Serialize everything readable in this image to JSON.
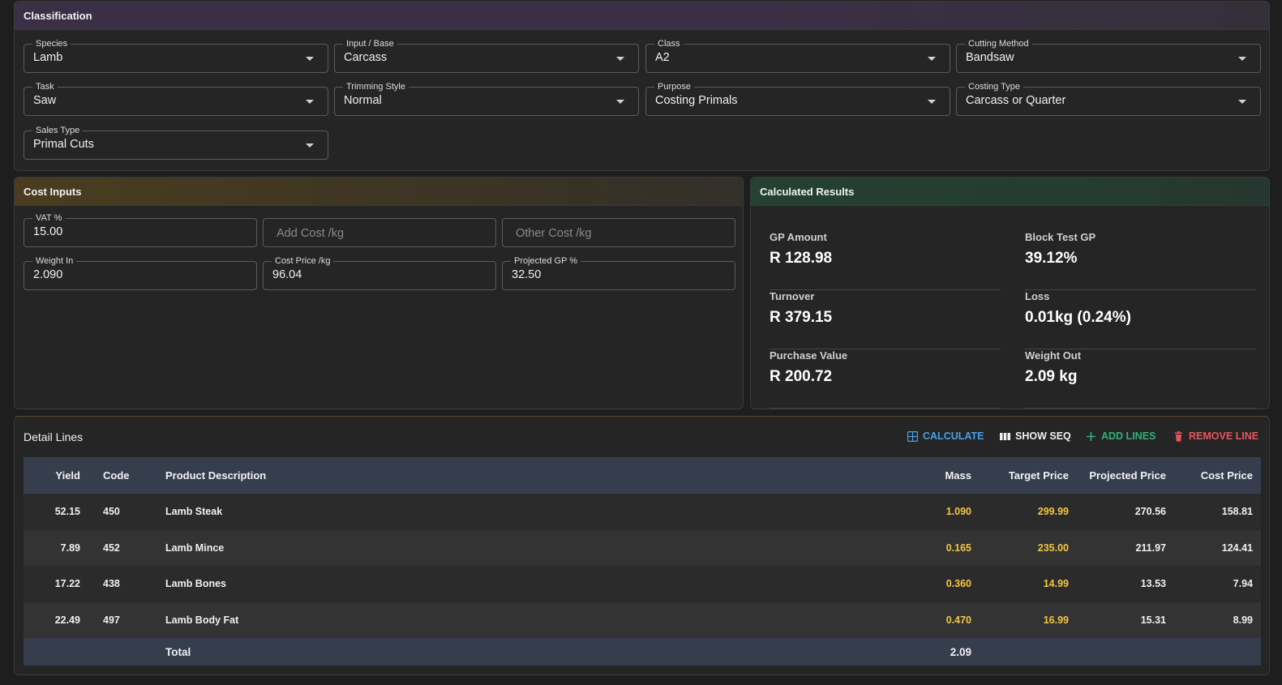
{
  "classification": {
    "title": "Classification",
    "fields": [
      {
        "label": "Species",
        "value": "Lamb"
      },
      {
        "label": "Input / Base",
        "value": "Carcass"
      },
      {
        "label": "Class",
        "value": "A2"
      },
      {
        "label": "Cutting Method",
        "value": "Bandsaw"
      },
      {
        "label": "Task",
        "value": "Saw"
      },
      {
        "label": "Trimming Style",
        "value": "Normal"
      },
      {
        "label": "Purpose",
        "value": "Costing Primals"
      },
      {
        "label": "Costing Type",
        "value": "Carcass or Quarter"
      },
      {
        "label": "Sales Type",
        "value": "Primal Cuts"
      }
    ]
  },
  "cost_inputs": {
    "title": "Cost Inputs",
    "vat": {
      "label": "VAT %",
      "value": "15.00"
    },
    "add_cost": {
      "placeholder": "Add Cost /kg"
    },
    "other_cost": {
      "placeholder": "Other Cost /kg"
    },
    "weight_in": {
      "label": "Weight In",
      "value": "2.090"
    },
    "cost_price": {
      "label": "Cost Price /kg",
      "value": "96.04"
    },
    "projected_gp": {
      "label": "Projected GP %",
      "value": "32.50"
    }
  },
  "results": {
    "title": "Calculated Results",
    "items": [
      {
        "label": "GP Amount",
        "value": "R 128.98"
      },
      {
        "label": "Block Test GP",
        "value": "39.12%"
      },
      {
        "label": "Turnover",
        "value": "R 379.15"
      },
      {
        "label": "Loss",
        "value": "0.01kg (0.24%)"
      },
      {
        "label": "Purchase Value",
        "value": "R 200.72"
      },
      {
        "label": "Weight Out",
        "value": "2.09 kg"
      }
    ]
  },
  "details": {
    "title": "Detail Lines",
    "buttons": {
      "calculate": "CALCULATE",
      "show_seq": "SHOW SEQ",
      "add_lines": "ADD LINES",
      "remove_line": "REMOVE LINE"
    },
    "columns": [
      "Yield",
      "Code",
      "Product Description",
      "Mass",
      "Target Price",
      "Projected Price",
      "Cost Price"
    ],
    "rows": [
      {
        "yield": "52.15",
        "code": "450",
        "desc": "Lamb Steak",
        "mass": "1.090",
        "target": "299.99",
        "projected": "270.56",
        "cost": "158.81"
      },
      {
        "yield": "7.89",
        "code": "452",
        "desc": "Lamb Mince",
        "mass": "0.165",
        "target": "235.00",
        "projected": "211.97",
        "cost": "124.41"
      },
      {
        "yield": "17.22",
        "code": "438",
        "desc": "Lamb Bones",
        "mass": "0.360",
        "target": "14.99",
        "projected": "13.53",
        "cost": "7.94"
      },
      {
        "yield": "22.49",
        "code": "497",
        "desc": "Lamb Body Fat",
        "mass": "0.470",
        "target": "16.99",
        "projected": "15.31",
        "cost": "8.99"
      }
    ],
    "total": {
      "label": "Total",
      "mass": "2.09"
    }
  },
  "colors": {
    "accent_yellow": "#f5c542",
    "calculate_blue": "#4a9fe8",
    "add_green": "#2fb37a",
    "remove_red": "#e8545e"
  }
}
